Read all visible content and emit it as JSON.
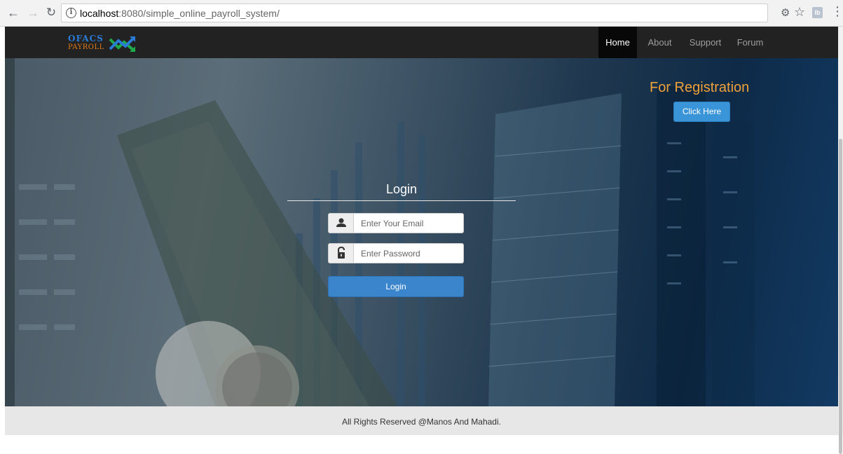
{
  "browser": {
    "url_host": "localhost",
    "url_path": ":8080/simple_online_payroll_system/"
  },
  "logo": {
    "line1": "OFACS",
    "line2": "PAYROLL"
  },
  "nav": {
    "items": [
      {
        "label": "Home",
        "active": true
      },
      {
        "label": "About",
        "active": false
      },
      {
        "label": "Support",
        "active": false
      },
      {
        "label": "Forum",
        "active": false
      }
    ]
  },
  "registration": {
    "title": "For Registration",
    "button_label": "Click Here"
  },
  "login": {
    "title": "Login",
    "email_placeholder": "Enter Your Email",
    "password_placeholder": "Enter Password",
    "button_label": "Login"
  },
  "footer": {
    "text": "All Rights Reserved @Manos And Mahadi."
  },
  "colors": {
    "navbar": "#222222",
    "accent_orange": "#f0a13a",
    "button_blue": "#3a85cc"
  }
}
